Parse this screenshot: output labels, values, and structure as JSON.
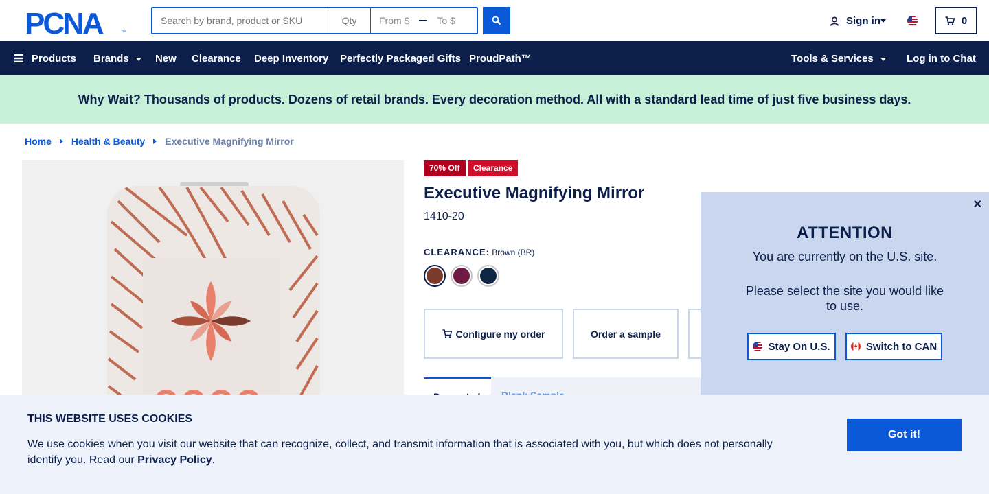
{
  "brand": {
    "logo_text": "PCNA",
    "logo_mark": "™",
    "primary_color": "#0b1f4a",
    "accent_color": "#0b59d8"
  },
  "search": {
    "keyword_placeholder": "Search by brand, product or SKU",
    "qty_placeholder": "Qty",
    "from_placeholder": "From $",
    "to_placeholder": "To $"
  },
  "header": {
    "sign_in": "Sign in",
    "cart_count": "0"
  },
  "nav": {
    "products": "Products",
    "brands": "Brands",
    "new": "New",
    "clearance": "Clearance",
    "deep_inventory": "Deep Inventory",
    "gifts": "Perfectly Packaged Gifts",
    "proudpath": "ProudPath™",
    "tools": "Tools & Services",
    "chat": "Log in to Chat"
  },
  "promo": "Why Wait? Thousands of products. Dozens of retail brands. Every decoration method. All with a standard lead time of just five business days.",
  "breadcrumb": {
    "home": "Home",
    "category": "Health & Beauty",
    "current": "Executive Magnifying Mirror"
  },
  "product": {
    "badge_discount": "70% Off",
    "badge_clearance": "Clearance",
    "badge_color": "#b0001e",
    "title": "Executive Magnifying Mirror",
    "sku": "1410-20",
    "color_label": "CLEARANCE:",
    "color_value": "Brown (BR)",
    "swatches": [
      "#7a3a2c",
      "#6f1a44",
      "#0f2544"
    ],
    "configure": "Configure my order",
    "sample": "Order a sample",
    "tab_active": "Decorated",
    "tab_2": "Blank Sample"
  },
  "modal": {
    "title": "ATTENTION",
    "line1": "You are currently on the U.S. site.",
    "line2": "Please select the site you would like to use.",
    "stay": "Stay On U.S.",
    "switch": "Switch to CAN",
    "close": "✕"
  },
  "cookie": {
    "title": "THIS WEBSITE USES COOKIES",
    "text": "We use cookies when you visit our website that can recognize, collect, and transmit information that is associated with you, but which does not personally identify you. Read our ",
    "link": "Privacy Policy",
    "end": ".",
    "button": "Got it!"
  }
}
